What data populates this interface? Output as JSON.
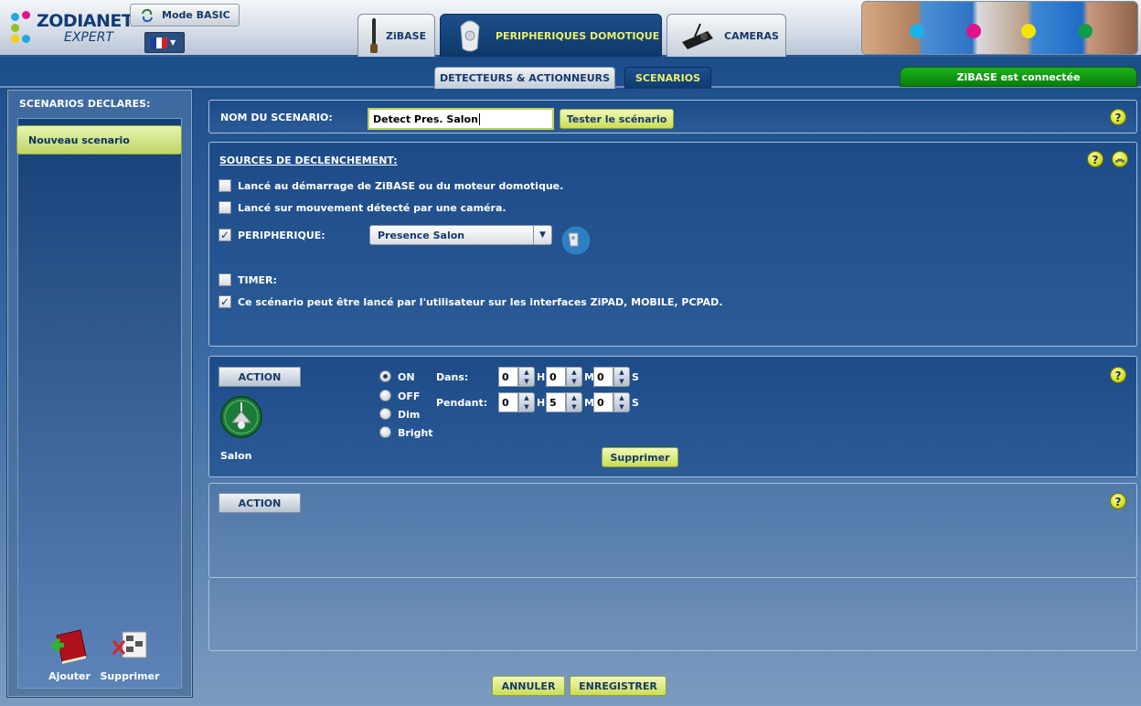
{
  "header": {
    "logo_text_top": "ZODIANET",
    "logo_text_bottom": "EXPERT",
    "mode_button": "Mode BASIC",
    "language": "FR",
    "tabs": [
      {
        "label": "ZiBASE",
        "icon": "antenna-icon",
        "active": false
      },
      {
        "label": "PERIPHERIQUES DOMOTIQUE",
        "icon": "device-icon",
        "active": true
      },
      {
        "label": "CAMERAS",
        "icon": "camera-icon",
        "active": false
      }
    ]
  },
  "subnav": {
    "tabs": [
      {
        "label": "DETECTEURS & ACTIONNEURS",
        "active": false
      },
      {
        "label": "SCENARIOS",
        "active": true
      }
    ],
    "status": "ZiBASE est connectée",
    "status_color": "#13a313"
  },
  "sidebar": {
    "title": "SCENARIOS DECLARES:",
    "items": [
      {
        "label": "Nouveau scenario",
        "selected": true
      }
    ],
    "add_label": "Ajouter",
    "delete_label": "Supprimer"
  },
  "scenario": {
    "name_label": "NOM DU SCENARIO:",
    "name_value": "Detect Pres. Salon",
    "test_button": "Tester le scénario"
  },
  "triggers": {
    "title": "SOURCES DE DECLENCHEMENT:",
    "options": [
      {
        "label": "Lancé au démarrage de ZiBASE ou du moteur domotique.",
        "checked": false
      },
      {
        "label": "Lancé sur mouvement détecté par une caméra.",
        "checked": false
      },
      {
        "label": "PERIPHERIQUE:",
        "checked": true
      },
      {
        "label": "TIMER:",
        "checked": false
      },
      {
        "label": "Ce scénario peut être lancé par l'utilisateur sur les interfaces ZiPAD, MOBILE, PCPAD.",
        "checked": true
      }
    ],
    "device_select": "Presence Salon"
  },
  "action1": {
    "header": "ACTION",
    "device_name": "Salon",
    "modes": [
      {
        "label": "ON",
        "selected": true
      },
      {
        "label": "OFF",
        "selected": false
      },
      {
        "label": "Dim",
        "selected": false
      },
      {
        "label": "Bright",
        "selected": false
      }
    ],
    "dans_label": "Dans:",
    "pendant_label": "Pendant:",
    "dans": {
      "h": "0",
      "m": "0",
      "s": "0"
    },
    "pendant": {
      "h": "0",
      "m": "5",
      "s": "0"
    },
    "units": {
      "h": "H",
      "m": "M",
      "s": "S"
    },
    "delete_button": "Supprimer"
  },
  "action2": {
    "header": "ACTION"
  },
  "footer": {
    "cancel": "ANNULER",
    "save": "ENREGISTRER"
  },
  "help_glyph": "?",
  "spin_up": "▲",
  "spin_down": "▼",
  "check_glyph": "✓",
  "collapse_glyph": "︽",
  "select_arrow": "▼"
}
